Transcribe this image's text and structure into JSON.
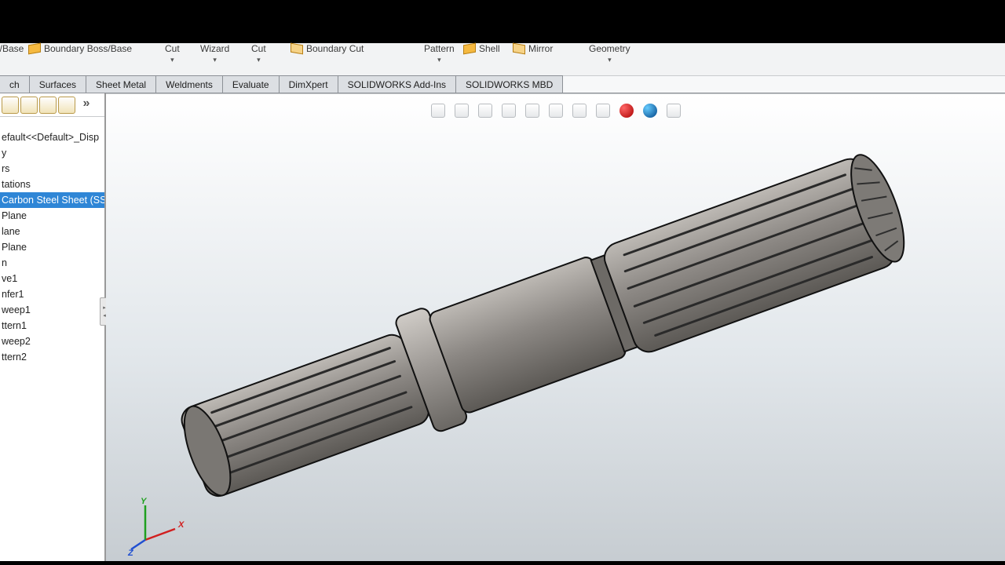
{
  "ribbon": {
    "base_label": "/Base",
    "boundary_boss": "Boundary Boss/Base",
    "cut": "Cut",
    "wizard": "Wizard",
    "cut2": "Cut",
    "boundary_cut": "Boundary Cut",
    "pattern": "Pattern",
    "shell": "Shell",
    "mirror": "Mirror",
    "geometry": "Geometry"
  },
  "tabs": [
    "ch",
    "Surfaces",
    "Sheet Metal",
    "Weldments",
    "Evaluate",
    "DimXpert",
    "SOLIDWORKS Add-Ins",
    "SOLIDWORKS MBD"
  ],
  "tree_toolbar": {
    "more": "»"
  },
  "tree": [
    "efault<<Default>_Disp",
    "y",
    "rs",
    "tations",
    "Carbon Steel Sheet (SS",
    "Plane",
    "lane",
    "Plane",
    "n",
    "ve1",
    "nfer1",
    "weep1",
    "ttern1",
    "weep2",
    "ttern2"
  ],
  "tree_selected_index": 4,
  "triad": {
    "x": "X",
    "y": "Y",
    "z": "Z"
  },
  "colors": {
    "axis_x": "#d11f1f",
    "axis_y": "#1fa01f",
    "axis_z": "#1f4fd1",
    "model_fill": "#8b8886",
    "model_hi": "#b2afab",
    "model_lo": "#5f5c59",
    "outline": "#111"
  }
}
